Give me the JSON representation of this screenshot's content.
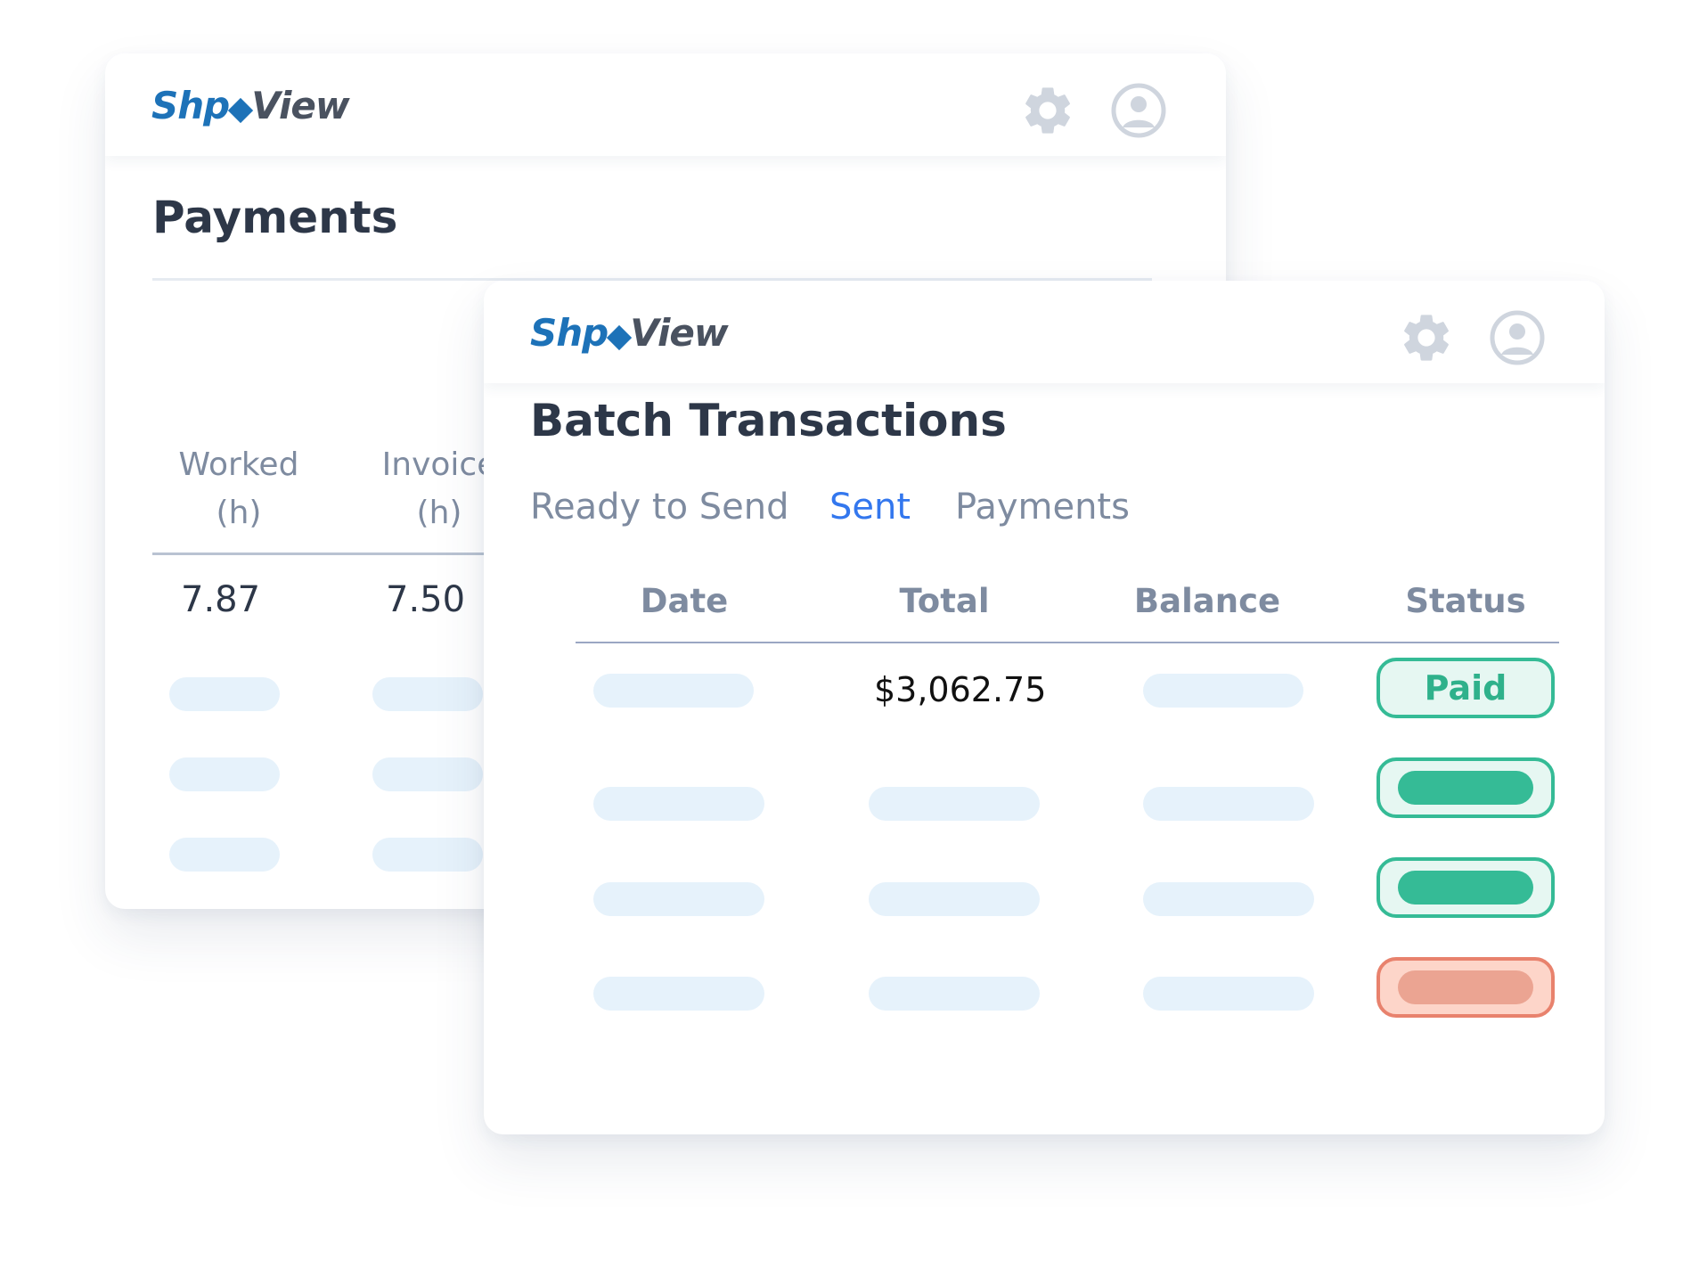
{
  "back_window": {
    "logo": {
      "part1": "Sh",
      "part2": "p",
      "part3": "View"
    },
    "title": "Payments",
    "columns": [
      {
        "line1": "Worked",
        "line2": "(h)"
      },
      {
        "line1": "Invoice",
        "line2": "(h)"
      }
    ],
    "row1": [
      "7.87",
      "7.50"
    ],
    "icons": {
      "settings": "gear-icon",
      "account": "user-circle-icon"
    }
  },
  "front_window": {
    "logo": {
      "part1": "Sh",
      "part2": "p",
      "part3": "View"
    },
    "title": "Batch Transactions",
    "tabs": [
      {
        "label": "Ready to Send",
        "active": false
      },
      {
        "label": "Sent",
        "active": true
      },
      {
        "label": "Payments",
        "active": false
      }
    ],
    "table": {
      "headers": [
        "Date",
        "Total",
        "Balance",
        "Status"
      ],
      "rows": [
        {
          "total": "$3,062.75",
          "status": "Paid",
          "status_color": "green"
        },
        {
          "total": "",
          "status": "",
          "status_color": "green"
        },
        {
          "total": "",
          "status": "",
          "status_color": "green"
        },
        {
          "total": "",
          "status": "",
          "status_color": "red"
        }
      ]
    },
    "icons": {
      "settings": "gear-icon",
      "account": "user-circle-icon"
    }
  },
  "colors": {
    "brand_blue": "#1d72b8",
    "brand_gray": "#4a5260",
    "active_tab": "#3377ee",
    "status_green": "#35bb96",
    "status_red": "#e8826d",
    "skeleton": "#e6f2fb"
  }
}
